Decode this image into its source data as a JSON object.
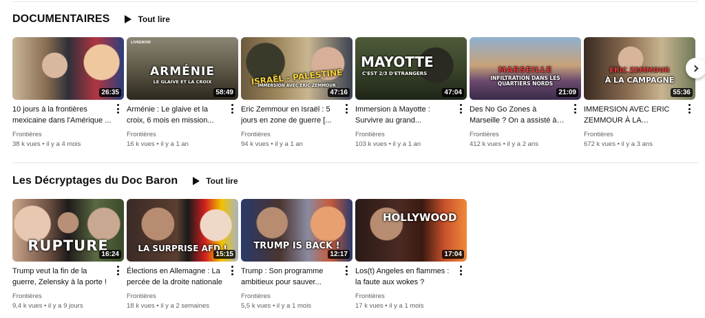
{
  "shelves": [
    {
      "title": "DOCUMENTAIRES",
      "play_all": "Tout lire",
      "videos": [
        {
          "title": "10 jours à la frontières mexicaine dans l'Amérique ...",
          "channel": "Frontières",
          "stats": "38 k vues • il y a 4 mois",
          "duration": "26:35",
          "caption": ""
        },
        {
          "title": "Arménie : Le glaive et la croix, 6 mois en mission...",
          "channel": "Frontières",
          "stats": "16 k vues • il y a 1 an",
          "duration": "58:49",
          "caption": "ARMÉNIE",
          "subcaption": "LE GLAIVE ET LA CROIX",
          "logo": "LIVRENOIR"
        },
        {
          "title": "Eric Zemmour en Israël : 5 jours en zone de guerre [...",
          "channel": "Frontières",
          "stats": "94 k vues • il y a 1 an",
          "duration": "47:16",
          "caption": "ISRAËL - PALESTINE",
          "subcaption": "IMMERSION AVEC ERIC ZEMMOUR"
        },
        {
          "title": "Immersion à Mayotte : Survivre au grand...",
          "channel": "Frontières",
          "stats": "103 k vues • il y a 1 an",
          "duration": "47:04",
          "caption": "MAYOTTE",
          "subcaption": "C'EST 2/3 D'ETRANGERS"
        },
        {
          "title": "Des No Go Zones à Marseille ? On a assisté à des...",
          "channel": "Frontières",
          "stats": "412 k vues • il y a 2 ans",
          "duration": "21:09",
          "caption": "MARSEILLE",
          "subcaption": "INFILTRATION DANS LES QUARTIERS NORDS"
        },
        {
          "title": "IMMERSION AVEC ERIC ZEMMOUR À LA CAMPAGN...",
          "channel": "Frontières",
          "stats": "672 k vues • il y a 3 ans",
          "duration": "55:36",
          "caption": "ERIC ZEMMOUR",
          "subcaption": "À LA CAMPAGNE"
        }
      ]
    },
    {
      "title": "Les Décryptages du Doc Baron",
      "play_all": "Tout lire",
      "videos": [
        {
          "title": "Trump veut la fin de la guerre, Zelensky à la porte !",
          "channel": "Frontières",
          "stats": "9,4 k vues • il y a 9 jours",
          "duration": "16:24",
          "caption": "RUPTURE"
        },
        {
          "title": "Élections en Allemagne : La percée de la droite nationale",
          "channel": "Frontières",
          "stats": "18 k vues • il y a 2 semaines",
          "duration": "15:15",
          "caption": "LA SURPRISE AFD !"
        },
        {
          "title": "Trump : Son programme ambitieux pour sauver...",
          "channel": "Frontières",
          "stats": "5,5 k vues • il y a 1 mois",
          "duration": "12:17",
          "caption": "TRUMP IS BACK !"
        },
        {
          "title": "Los(t) Angeles en flammes : la faute aux wokes ?",
          "channel": "Frontières",
          "stats": "17 k vues • il y a 1 mois",
          "duration": "17:04",
          "caption": "HOLLYWOOD"
        }
      ]
    }
  ],
  "icons": {
    "play_all": "play-icon",
    "more": "more-vert-icon",
    "next": "chevron-right-icon"
  },
  "colors": {
    "text": "#0f0f0f",
    "meta": "#606060",
    "duration_bg": "#000000"
  }
}
